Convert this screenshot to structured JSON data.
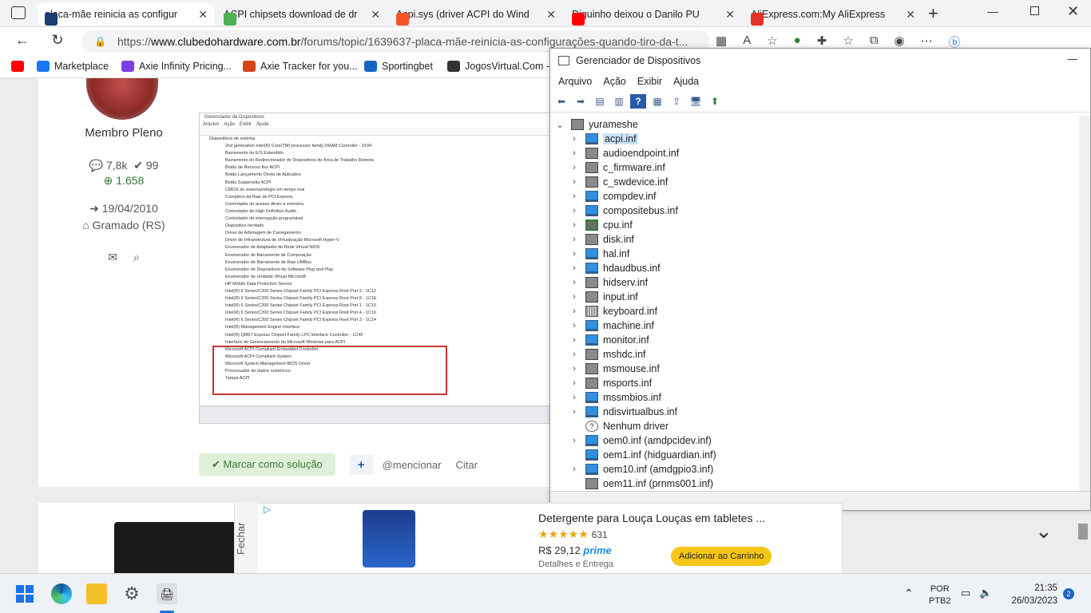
{
  "browser": {
    "tabs": [
      {
        "label": "placa-mãe reinicia as configur",
        "icon": "clubedohardware-icon",
        "active": true
      },
      {
        "label": "ACPI chipsets download de dr",
        "icon": "puzzle-site-icon"
      },
      {
        "label": "Acpi.sys (driver ACPI do Wind",
        "icon": "microsoft-icon"
      },
      {
        "label": "Diguinho deixou o Danilo PU",
        "icon": "youtube-icon"
      },
      {
        "label": "AliExpress.com:My AliExpress",
        "icon": "aliexpress-icon"
      }
    ],
    "url_prefix": "https://",
    "url_domain": "www.clubedohardware.com.br",
    "url_path": "/forums/topic/1639637-placa-mãe-reinicia-as-configurações-quando-tiro-da-t...",
    "favorites": [
      {
        "label": "",
        "icon": "youtube-icon"
      },
      {
        "label": "Marketplace",
        "icon": "marketplace-icon"
      },
      {
        "label": "Axie Infinity Pricing...",
        "icon": "axie-pricing-icon"
      },
      {
        "label": "Axie Tracker for you...",
        "icon": "axie-tracker-icon"
      },
      {
        "label": "Sportingbet",
        "icon": "sportingbet-icon"
      },
      {
        "label": "JogosVirtual.Com -...",
        "icon": "soccer-ball-icon"
      }
    ]
  },
  "profile": {
    "role": "Membro Pleno",
    "posts": "7,8k",
    "reputation": "99",
    "points": "1.658",
    "joined": "19/04/2010",
    "location": "Gramado (RS)"
  },
  "post_image": {
    "title": "Gerenciador de Dispositivos",
    "menu": [
      "Arquivo",
      "Ação",
      "Exibir",
      "Ajuda"
    ],
    "category": "Dispositivos de sistema",
    "items": [
      "2nd generation Intel(R) Core(TM) processor family DRAM Controller - 0104",
      "Barramento de E/S Estendido",
      "Barramento do Redirecionador de Dispositivos de Área de Trabalho Remota",
      "Botão de Recurso fixo ACPI",
      "Botão Lançamento Direto de Aplicativo",
      "Botão Suspensão ACPI",
      "CMOS do sistema/relógio em tempo real",
      "Complexo da Raiz de PCI Express",
      "Controlador de acesso direto à memória",
      "Controlador de High Definition Audio",
      "Controlador de interrupção programável",
      "Dispositivo herdado",
      "Driver de Arbitragem de Carregamento",
      "Driver de Infraestrutura de Virtualização Microsoft Hyper-V",
      "Enumerador de Adaptador de Rede Virtual NDIS",
      "Enumerador de Barramento de Composição",
      "Enumerador de Barramento de Raiz UMBus",
      "Enumerador de Dispositivos de Software Plug and Play",
      "Enumerador de Unidade Virtual Microsoft",
      "HP Mobile Data Protection Sensor",
      "Intel(R) 6 Series/C200 Series Chipset Family PCI Express Root Port 2 - 1C12",
      "Intel(R) 6 Series/C200 Series Chipset Family PCI Express Root Port 8 - 1C1E",
      "Intel(R) 6 Series/C200 Series Chipset Family PCI Express Root Port 1 - 1C10",
      "Intel(R) 6 Series/C200 Series Chipset Family PCI Express Root Port 4 - 1C16",
      "Intel(R) 6 Series/C200 Series Chipset Family PCI Express Root Port 3 - 1C14",
      "Intel(R) Management Engine Interface",
      "Intel(R) QM67 Express Chipset Family LPC Interface Controller - 1C4F",
      "Interface de Gerenciamento do Microsoft Windows para ACPI",
      "Microsoft ACPI-Compliant Embedded Controller",
      "Microsoft ACPI-Compliant System",
      "Microsoft System Management BIOS Driver",
      "Processador de dados numéricos",
      "Tampa ACPI"
    ]
  },
  "post_actions": {
    "mark_solution": "Marcar como solução",
    "add": "+",
    "mention": "@mencionar",
    "quote": "Citar"
  },
  "device_manager": {
    "title": "Gerenciador de Dispositivos",
    "menu": [
      "Arquivo",
      "Ação",
      "Exibir",
      "Ajuda"
    ],
    "root": "yurameshe",
    "items": [
      {
        "label": "acpi.inf",
        "icon": "mon",
        "selected": true
      },
      {
        "label": "audioendpoint.inf",
        "icon": "gen"
      },
      {
        "label": "c_firmware.inf",
        "icon": "gen"
      },
      {
        "label": "c_swdevice.inf",
        "icon": "gen"
      },
      {
        "label": "compdev.inf",
        "icon": "mon"
      },
      {
        "label": "compositebus.inf",
        "icon": "mon"
      },
      {
        "label": "cpu.inf",
        "icon": "chip"
      },
      {
        "label": "disk.inf",
        "icon": "gen"
      },
      {
        "label": "hal.inf",
        "icon": "mon"
      },
      {
        "label": "hdaudbus.inf",
        "icon": "mon"
      },
      {
        "label": "hidserv.inf",
        "icon": "gen"
      },
      {
        "label": "input.inf",
        "icon": "gen"
      },
      {
        "label": "keyboard.inf",
        "icon": "kb"
      },
      {
        "label": "machine.inf",
        "icon": "mon"
      },
      {
        "label": "monitor.inf",
        "icon": "mon"
      },
      {
        "label": "mshdc.inf",
        "icon": "gen"
      },
      {
        "label": "msmouse.inf",
        "icon": "gen"
      },
      {
        "label": "msports.inf",
        "icon": "gen"
      },
      {
        "label": "mssmbios.inf",
        "icon": "mon"
      },
      {
        "label": "ndisvirtualbus.inf",
        "icon": "mon"
      },
      {
        "label": "Nenhum driver",
        "icon": "q",
        "nochev": true
      },
      {
        "label": "oem0.inf (amdpcidev.inf)",
        "icon": "mon"
      },
      {
        "label": "oem1.inf (hidguardian.inf)",
        "icon": "mon",
        "nochev": true
      },
      {
        "label": "oem10.inf (amdgpio3.inf)",
        "icon": "mon"
      },
      {
        "label": "oem11.inf (prnms001.inf)",
        "icon": "gen",
        "nochev": true
      }
    ]
  },
  "ad": {
    "close_label": "Fechar",
    "product": "Detergente para Louça Louças em tabletes ...",
    "rating_count": "631",
    "price": "R$ 29,12",
    "prime": "prime",
    "details": "Detalhes e Entrega",
    "cta": "Adicionar ao Carrinho"
  },
  "taskbar": {
    "lang": "POR",
    "layout": "PTB2",
    "time": "21:35",
    "date": "26/03/2023",
    "notifications": "2"
  }
}
